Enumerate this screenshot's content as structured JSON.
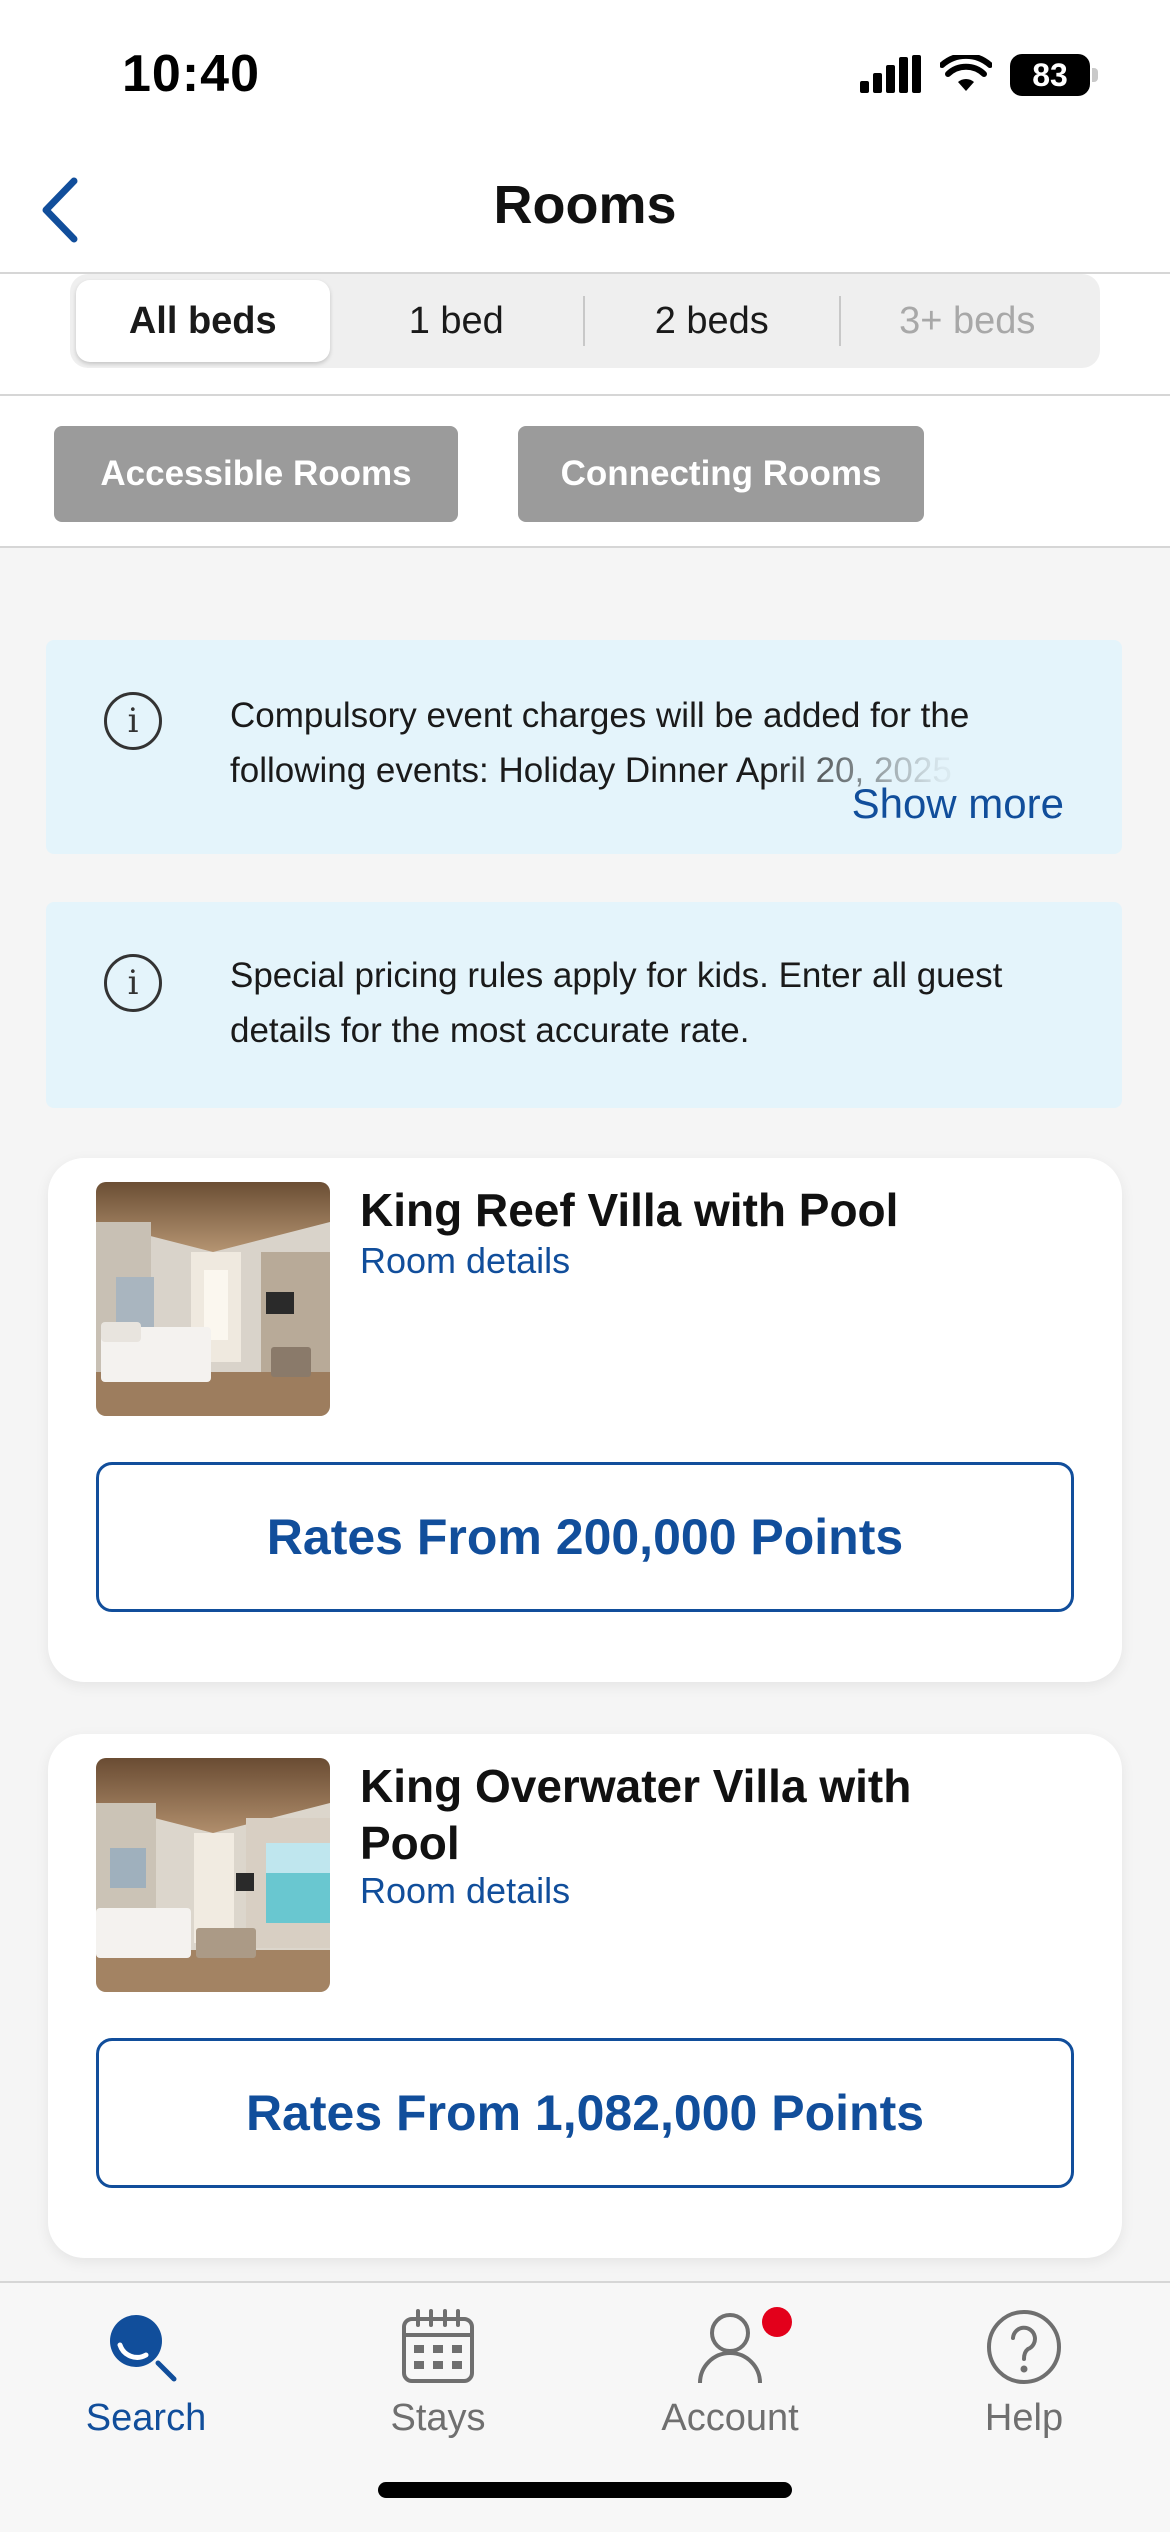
{
  "status": {
    "time": "10:40",
    "battery": "83"
  },
  "nav": {
    "title": "Rooms"
  },
  "segments": [
    {
      "label": "All beds"
    },
    {
      "label": "1 bed"
    },
    {
      "label": "2 beds"
    },
    {
      "label": "3+ beds"
    }
  ],
  "filters": [
    {
      "label": "Accessible Rooms"
    },
    {
      "label": "Connecting Rooms"
    }
  ],
  "banners": [
    {
      "icon": "info-icon",
      "text": "Compulsory event charges will be added for the following events: Holiday Dinner April 20, 2025",
      "action": "Show more"
    },
    {
      "icon": "info-icon",
      "text": "Special pricing rules apply for kids. Enter all guest details for the most accurate rate."
    }
  ],
  "rooms": [
    {
      "name": "King Reef Villa with Pool",
      "details_link": "Room details",
      "rates_label": "Rates From 200,000 Points"
    },
    {
      "name": "King Overwater Villa with Pool",
      "details_link": "Room details",
      "rates_label": "Rates From 1,082,000 Points"
    }
  ],
  "tabs": [
    {
      "label": "Search",
      "icon": "search-icon",
      "active": true
    },
    {
      "label": "Stays",
      "icon": "calendar-icon"
    },
    {
      "label": "Account",
      "icon": "person-icon",
      "badge": true
    },
    {
      "label": "Help",
      "icon": "question-icon"
    }
  ],
  "colors": {
    "brand_blue": "#114e9b",
    "banner_bg": "#e4f4fb",
    "chip_gray": "#9b9b9b",
    "badge_red": "#e3001b"
  }
}
